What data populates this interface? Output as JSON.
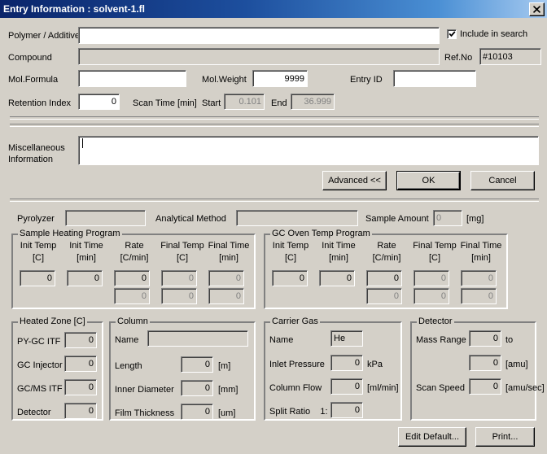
{
  "window": {
    "title": "Entry Information : solvent-1.fl",
    "close_label": "✕",
    "titlebar_color": "#0a246a",
    "face_color": "#d4d0c8"
  },
  "top": {
    "polymer_label": "Polymer / Additive",
    "polymer_value": "",
    "include_in_search_label": "Include in search",
    "include_in_search_checked": true,
    "compound_label": "Compound",
    "compound_value": "",
    "refno_label": "Ref.No",
    "refno_value": "#10103",
    "molformula_label": "Mol.Formula",
    "molformula_value": "",
    "molweight_label": "Mol.Weight",
    "molweight_value": "9999",
    "entryid_label": "Entry ID",
    "entryid_value": "",
    "retention_label": "Retention Index",
    "retention_value": "0",
    "scantime_label": "Scan Time [min]",
    "start_label": "Start",
    "start_value": "0.101",
    "end_label": "End",
    "end_value": "36.999"
  },
  "misc": {
    "label_line1": "Miscellaneous",
    "label_line2": "Information",
    "value": ""
  },
  "dialog_buttons": {
    "advanced": "Advanced <<",
    "ok": "OK",
    "cancel": "Cancel"
  },
  "instrument": {
    "pyrolyzer_label": "Pyrolyzer",
    "pyrolyzer_value": "",
    "analytical_method_label": "Analytical Method",
    "analytical_method_value": "",
    "sample_amount_label": "Sample Amount",
    "sample_amount_value": "0",
    "sample_amount_unit": "[mg]"
  },
  "sample_heating": {
    "title": "Sample Heating Program",
    "columns": [
      {
        "name": "Init Temp",
        "unit": "[C]"
      },
      {
        "name": "Init Time",
        "unit": "[min]"
      },
      {
        "name": "Rate",
        "unit": "[C/min]"
      },
      {
        "name": "Final Temp",
        "unit": "[C]"
      },
      {
        "name": "Final Time",
        "unit": "[min]"
      }
    ],
    "row1": [
      "0",
      "0",
      "0",
      "0",
      "0"
    ],
    "row2": [
      "0",
      "0",
      "0"
    ]
  },
  "gc_oven": {
    "title": "GC Oven Temp Program",
    "columns": [
      {
        "name": "Init Temp",
        "unit": "[C]"
      },
      {
        "name": "Init Time",
        "unit": "[min]"
      },
      {
        "name": "Rate",
        "unit": "[C/min]"
      },
      {
        "name": "Final Temp",
        "unit": "[C]"
      },
      {
        "name": "Final Time",
        "unit": "[min]"
      }
    ],
    "row1": [
      "0",
      "0",
      "0",
      "0",
      "0"
    ],
    "row2": [
      "0",
      "0",
      "0"
    ]
  },
  "heated_zone": {
    "title": "Heated Zone [C]",
    "rows": [
      {
        "label": "PY-GC ITF",
        "value": "0"
      },
      {
        "label": "GC Injector",
        "value": "0"
      },
      {
        "label": "GC/MS ITF",
        "value": "0"
      },
      {
        "label": "Detector",
        "value": "0"
      }
    ]
  },
  "column": {
    "title": "Column",
    "name_label": "Name",
    "name_value": "",
    "rows": [
      {
        "label": "Length",
        "value": "0",
        "unit": "[m]"
      },
      {
        "label": "Inner Diameter",
        "value": "0",
        "unit": "[mm]"
      },
      {
        "label": "Film Thickness",
        "value": "0",
        "unit": "[um]"
      }
    ]
  },
  "carrier_gas": {
    "title": "Carrier Gas",
    "name_label": "Name",
    "name_value": "He",
    "rows": [
      {
        "label": "Inlet Pressure",
        "value": "0",
        "unit": "kPa"
      },
      {
        "label": "Column Flow",
        "value": "0",
        "unit": "[ml/min]"
      },
      {
        "label": "Split Ratio    1:",
        "value": "0",
        "unit": ""
      }
    ]
  },
  "detector": {
    "title": "Detector",
    "mass_range_label": "Mass Range",
    "mass_range_from": "0",
    "mass_range_to_label": "to",
    "mass_range_value2": "0",
    "mass_range_unit": "[amu]",
    "scan_speed_label": "Scan Speed",
    "scan_speed_value": "0",
    "scan_speed_unit": "[amu/sec]"
  },
  "footer_buttons": {
    "edit_default": "Edit Default...",
    "print": "Print..."
  }
}
